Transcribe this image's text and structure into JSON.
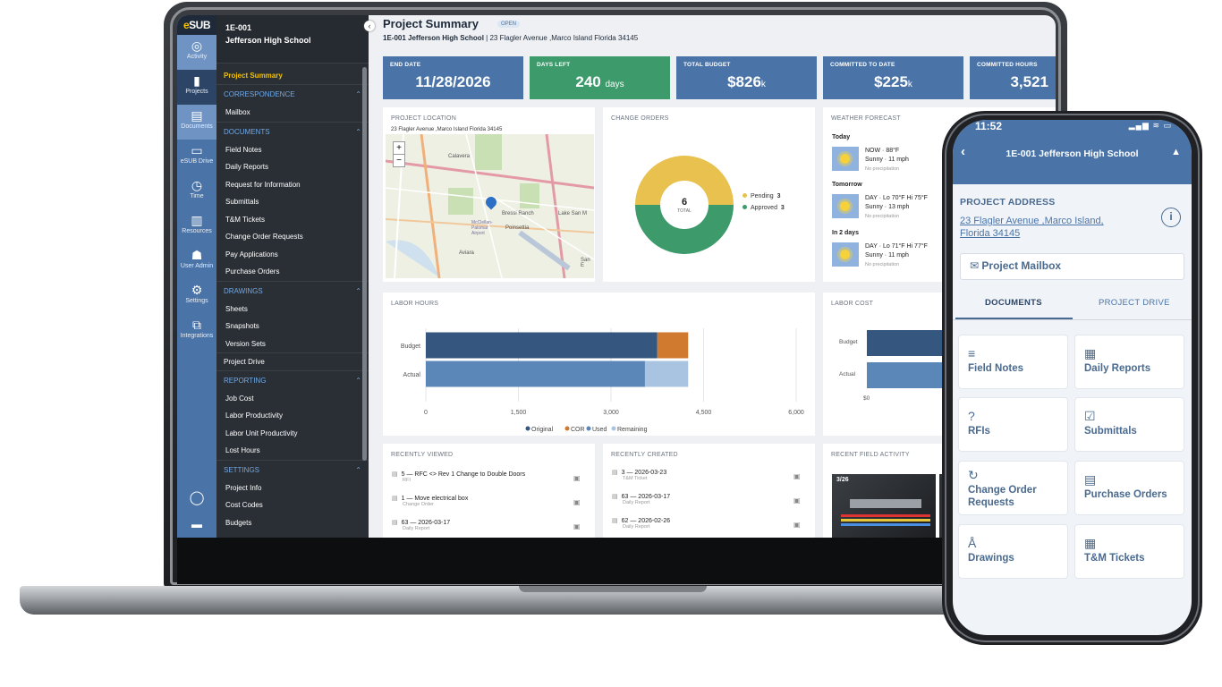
{
  "app": {
    "logo": "SUB",
    "logo_mark": "e",
    "rail": [
      {
        "label": "Activity",
        "icon": "activity-icon",
        "glyph": "◎"
      },
      {
        "label": "Projects",
        "icon": "clipboard-icon",
        "glyph": "▮"
      },
      {
        "label": "Documents",
        "icon": "document-icon",
        "glyph": "▤"
      },
      {
        "label": "eSUB Drive",
        "icon": "folder-icon",
        "glyph": "▭"
      },
      {
        "label": "Time",
        "icon": "clock-icon",
        "glyph": "◷"
      },
      {
        "label": "Resources",
        "icon": "resources-icon",
        "glyph": "▥"
      },
      {
        "label": "User Admin",
        "icon": "users-icon",
        "glyph": "☗"
      },
      {
        "label": "Settings",
        "icon": "gear-icon",
        "glyph": "⚙"
      },
      {
        "label": "Integrations",
        "icon": "integrations-icon",
        "glyph": "⧉"
      }
    ]
  },
  "nav": {
    "project_code": "1E-001",
    "project_name": "Jefferson High School",
    "current": "Project Summary",
    "sections": {
      "correspondence": "CORRESPONDENCE",
      "documents": "DOCUMENTS",
      "drawings": "DRAWINGS",
      "reporting": "REPORTING",
      "settings": "SETTINGS"
    },
    "correspondence_items": [
      "Mailbox"
    ],
    "documents_items": [
      "Field Notes",
      "Daily Reports",
      "Request for Information",
      "Submittals",
      "T&M Tickets",
      "Change Order Requests",
      "Pay Applications",
      "Purchase Orders"
    ],
    "drawings_items": [
      "Sheets",
      "Snapshots",
      "Version Sets"
    ],
    "project_drive": "Project Drive",
    "reporting_items": [
      "Job Cost",
      "Labor Productivity",
      "Labor Unit Productivity",
      "Lost Hours"
    ],
    "settings_items": [
      "Project Info",
      "Cost Codes",
      "Budgets"
    ]
  },
  "header": {
    "title": "Project Summary",
    "status": "OPEN",
    "project": "1E-001 Jefferson High School",
    "address": "23 Flagler Avenue ,Marco Island Florida 34145"
  },
  "kpis": [
    {
      "label": "END DATE",
      "value": "11/28/2026",
      "unit": "",
      "color": "#4a74a8"
    },
    {
      "label": "DAYS LEFT",
      "value": "240",
      "unit": "days",
      "color": "#3d9a6b"
    },
    {
      "label": "TOTAL BUDGET",
      "value": "$826",
      "unit": "k",
      "color": "#4a74a8"
    },
    {
      "label": "COMMITTED TO DATE",
      "value": "$225",
      "unit": "k",
      "color": "#4a74a8"
    },
    {
      "label": "COMMITTED HOURS",
      "value": "3,521",
      "unit": "",
      "color": "#4a74a8"
    }
  ],
  "location": {
    "title": "PROJECT LOCATION",
    "address": "23 Flagler Avenue ,Marco Island Florida 34145",
    "zoom_in": "+",
    "zoom_out": "−",
    "places": [
      "Calavera",
      "Bressi Ranch",
      "Lake San M",
      "Poinsettia",
      "Aviara",
      "San E",
      "McClellan-Palomar Airport"
    ]
  },
  "change_orders": {
    "title": "CHANGE ORDERS",
    "total": "6",
    "total_label": "TOTAL",
    "items": [
      {
        "label": "Pending",
        "count": "3",
        "color": "#e8c14f"
      },
      {
        "label": "Approved",
        "count": "3",
        "color": "#3d9a6b"
      }
    ]
  },
  "weather": {
    "title": "WEATHER FORECAST",
    "days": [
      {
        "day": "Today",
        "line1": "NOW · 88°F",
        "line2": "Sunny · 11 mph",
        "line3": "No precipitation"
      },
      {
        "day": "Tomorrow",
        "line1": "DAY · Lo 70°F Hi 75°F",
        "line2": "Sunny · 13 mph",
        "line3": "No precipitation"
      },
      {
        "day": "In 2 days",
        "line1": "DAY · Lo 71°F Hi 77°F",
        "line2": "Sunny · 11 mph",
        "line3": "No precipitation"
      }
    ]
  },
  "labor_hours": {
    "title": "LABOR HOURS"
  },
  "labor_cost": {
    "title": "LABOR COST",
    "categories": [
      "Budget",
      "Actual"
    ],
    "x_tick": "$0"
  },
  "chart_data": {
    "type": "bar",
    "orientation": "horizontal",
    "stacked": true,
    "title": "LABOR HOURS",
    "categories": [
      "Budget",
      "Actual"
    ],
    "series": [
      {
        "name": "Original",
        "color": "#35577f",
        "values": [
          3750,
          0
        ]
      },
      {
        "name": "COR",
        "color": "#d07a30",
        "values": [
          500,
          0
        ]
      },
      {
        "name": "Used",
        "color": "#5b86b8",
        "values": [
          0,
          3550
        ]
      },
      {
        "name": "Remaining",
        "color": "#a9c4e0",
        "values": [
          0,
          700
        ]
      }
    ],
    "xlim": [
      0,
      6000
    ],
    "xticks": [
      "0",
      "1,500",
      "3,000",
      "4,500",
      "6,000"
    ],
    "grid": true,
    "legend": "bottom"
  },
  "recently_viewed": {
    "title": "RECENTLY VIEWED",
    "items": [
      {
        "title": "5 — RFC <> Rev 1 Change to Double Doors",
        "type": "RFI"
      },
      {
        "title": "1 — Move electrical box",
        "type": "Change Order"
      },
      {
        "title": "63 — 2026-03-17",
        "type": "Daily Report"
      }
    ]
  },
  "recently_created": {
    "title": "RECENTLY CREATED",
    "items": [
      {
        "title": "3 — 2026-03-23",
        "type": "T&M Ticket"
      },
      {
        "title": "63 — 2026-03-17",
        "type": "Daily Report"
      },
      {
        "title": "62 — 2026-02-26",
        "type": "Daily Report"
      }
    ]
  },
  "field_activity": {
    "title": "RECENT FIELD ACTIVITY",
    "photo_date": "3/26"
  },
  "phone": {
    "time": "11:52",
    "status_icons": "▂▄▆ ≋ ▭",
    "title": "1E-001 Jefferson High School",
    "address_label": "PROJECT ADDRESS",
    "address": "23 Flagler Avenue ,Marco Island, Florida 34145",
    "mailbox": "Project Mailbox",
    "tabs": [
      "DOCUMENTS",
      "PROJECT DRIVE"
    ],
    "tiles": [
      {
        "label": "Field Notes",
        "icon": "field-notes-icon",
        "glyph": "≡"
      },
      {
        "label": "Daily Reports",
        "icon": "calendar-icon",
        "glyph": "▦"
      },
      {
        "label": "RFIs",
        "icon": "rfi-icon",
        "glyph": "?"
      },
      {
        "label": "Submittals",
        "icon": "submittals-icon",
        "glyph": "☑"
      },
      {
        "label": "Change Order Requests",
        "icon": "change-order-icon",
        "glyph": "↻"
      },
      {
        "label": "Purchase Orders",
        "icon": "purchase-orders-icon",
        "glyph": "▤"
      },
      {
        "label": "Drawings",
        "icon": "drawings-icon",
        "glyph": "Å"
      },
      {
        "label": "T&M Tickets",
        "icon": "tm-tickets-icon",
        "glyph": "▦"
      }
    ]
  }
}
